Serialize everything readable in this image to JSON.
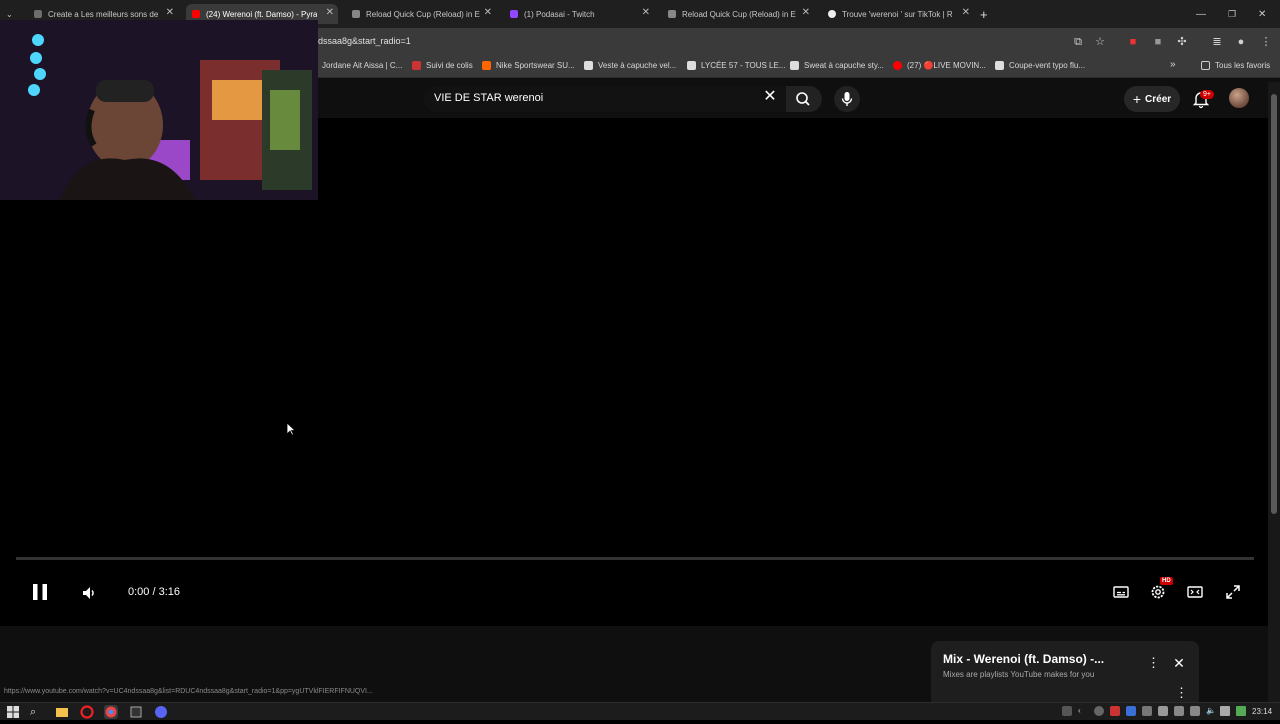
{
  "browser": {
    "tabs": [
      {
        "label": "Create a Les meilleurs sons de",
        "active": false
      },
      {
        "label": "(24) Werenoi (ft. Damso) - Pyra",
        "active": true
      },
      {
        "label": "Reload Quick Cup (Reload) in E",
        "active": false
      },
      {
        "label": "(1) Podasai - Twitch",
        "active": false
      },
      {
        "label": "Reload Quick Cup (Reload) in E",
        "active": false
      },
      {
        "label": "Trouve 'werenoi ' sur TikTok | R",
        "active": false
      }
    ],
    "new_tab_label": "+",
    "url": "dssaa8g&start_radio=1",
    "bookmarks": [
      {
        "label": "Jordane Ait Aissa | C...",
        "icon": "link-icon"
      },
      {
        "label": "Suivi de colis",
        "icon": "tracking-icon"
      },
      {
        "label": "Nike Sportswear SU...",
        "icon": "nike-icon"
      },
      {
        "label": "Veste à capuche vel...",
        "icon": "shop-icon"
      },
      {
        "label": "LYCÉE 57 - TOUS LE...",
        "icon": "school-icon"
      },
      {
        "label": "Sweat à capuche sty...",
        "icon": "shop-icon"
      },
      {
        "label": "(27) 🔴LIVE MOVIN...",
        "icon": "youtube-icon"
      },
      {
        "label": "Coupe-vent typo flu...",
        "icon": "shop-icon"
      }
    ],
    "bookmarks_overflow": "»",
    "all_bookmarks": "Tous les favoris"
  },
  "youtube": {
    "search_value": "VIE DE STAR werenoi",
    "create_label": "Créer",
    "notification_badge": "9+",
    "player": {
      "current_time": "0:00",
      "duration": "3:16",
      "time_display": "0:00 / 3:16",
      "progress_fraction": 0.0,
      "hd_badge": "HD"
    },
    "mix_card": {
      "title": "Mix - Werenoi (ft. Damso) -...",
      "subtitle": "Mixes are playlists YouTube makes for you"
    },
    "status_url": "https://www.youtube.com/watch?v=UC4ndssaa8g&list=RDUC4ndssaa8g&start_radio=1&pp=ygUTVklFIERFIFNUQVI..."
  },
  "taskbar": {
    "clock": "23:14"
  },
  "colors": {
    "accent_red": "#ff0000",
    "page_bg": "#0f0f0f",
    "chrome_bg": "#3a3a3a"
  }
}
